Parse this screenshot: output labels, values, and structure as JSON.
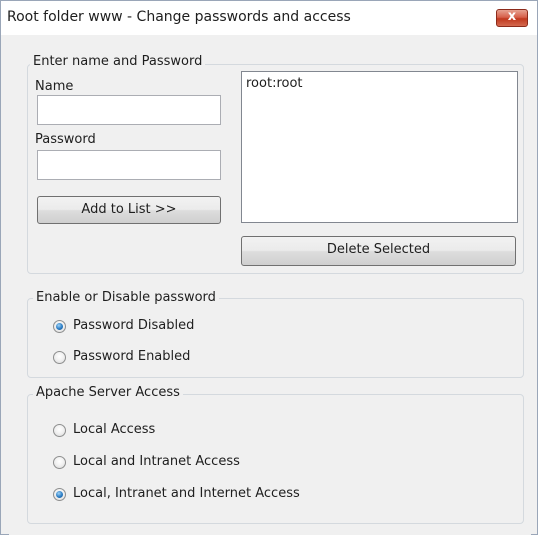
{
  "window": {
    "title": "Root folder www - Change passwords and access",
    "close_glyph": "x"
  },
  "credentials_group": {
    "legend": "Enter name and Password",
    "name_label": "Name",
    "name_value": "",
    "password_label": "Password",
    "password_value": "",
    "add_button": "Add to List >>",
    "list_items": [
      "root:root"
    ],
    "delete_button": "Delete Selected"
  },
  "password_mode_group": {
    "legend": "Enable or Disable password",
    "options": [
      {
        "label": "Password Disabled",
        "checked": true
      },
      {
        "label": "Password Enabled",
        "checked": false
      }
    ]
  },
  "access_group": {
    "legend": "Apache Server Access",
    "options": [
      {
        "label": "Local Access",
        "checked": false
      },
      {
        "label": "Local and Intranet Access",
        "checked": false
      },
      {
        "label": "Local, Intranet and Internet Access",
        "checked": true
      }
    ]
  }
}
